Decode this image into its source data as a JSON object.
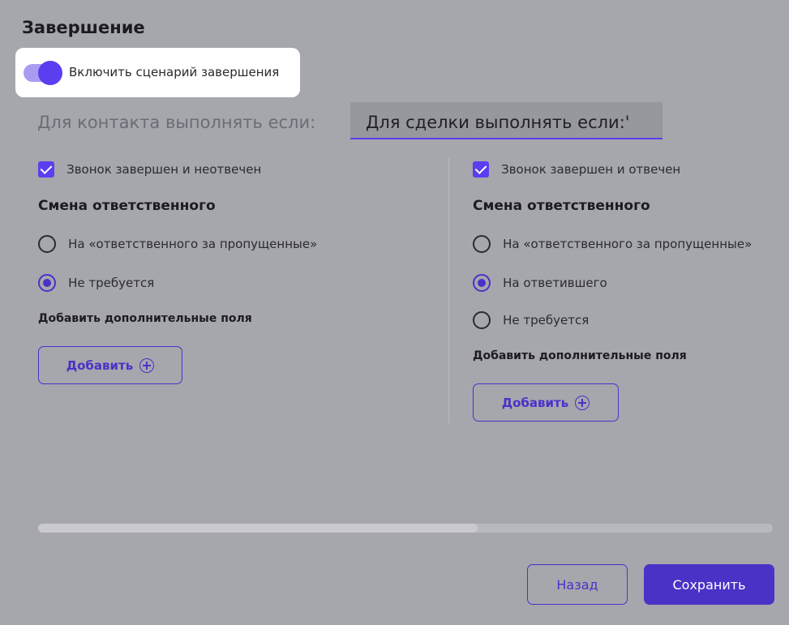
{
  "title": "Завершение",
  "toggle": {
    "label": "Включить сценарий завершения",
    "on": true
  },
  "tabs": [
    {
      "label": "Для контакта выполнять если:",
      "active": false
    },
    {
      "label": "Для сделки выполнять если:'",
      "active": true
    }
  ],
  "left": {
    "checkbox_label": "Звонок завершен и неотвечен",
    "section_title": "Смена ответственного",
    "radios": [
      {
        "label": "На «ответственного за пропущенные»",
        "selected": false
      },
      {
        "label": "Не требуется",
        "selected": true
      }
    ],
    "fields_title": "Добавить дополнительные поля",
    "add_label": "Добавить"
  },
  "right": {
    "checkbox_label": "Звонок завершен и отвечен",
    "section_title": "Смена ответственного",
    "radios": [
      {
        "label": "На «ответственного за пропущенные»",
        "selected": false
      },
      {
        "label": "На ответившего",
        "selected": true
      },
      {
        "label": "Не требуется",
        "selected": false
      }
    ],
    "fields_title": "Добавить дополнительные поля",
    "add_label": "Добавить"
  },
  "scrollbar": {
    "position": 0.6
  },
  "footer": {
    "back_label": "Назад",
    "save_label": "Сохранить"
  },
  "colors": {
    "accent": "#4b32c6",
    "overlay": "#a6a6ad"
  }
}
